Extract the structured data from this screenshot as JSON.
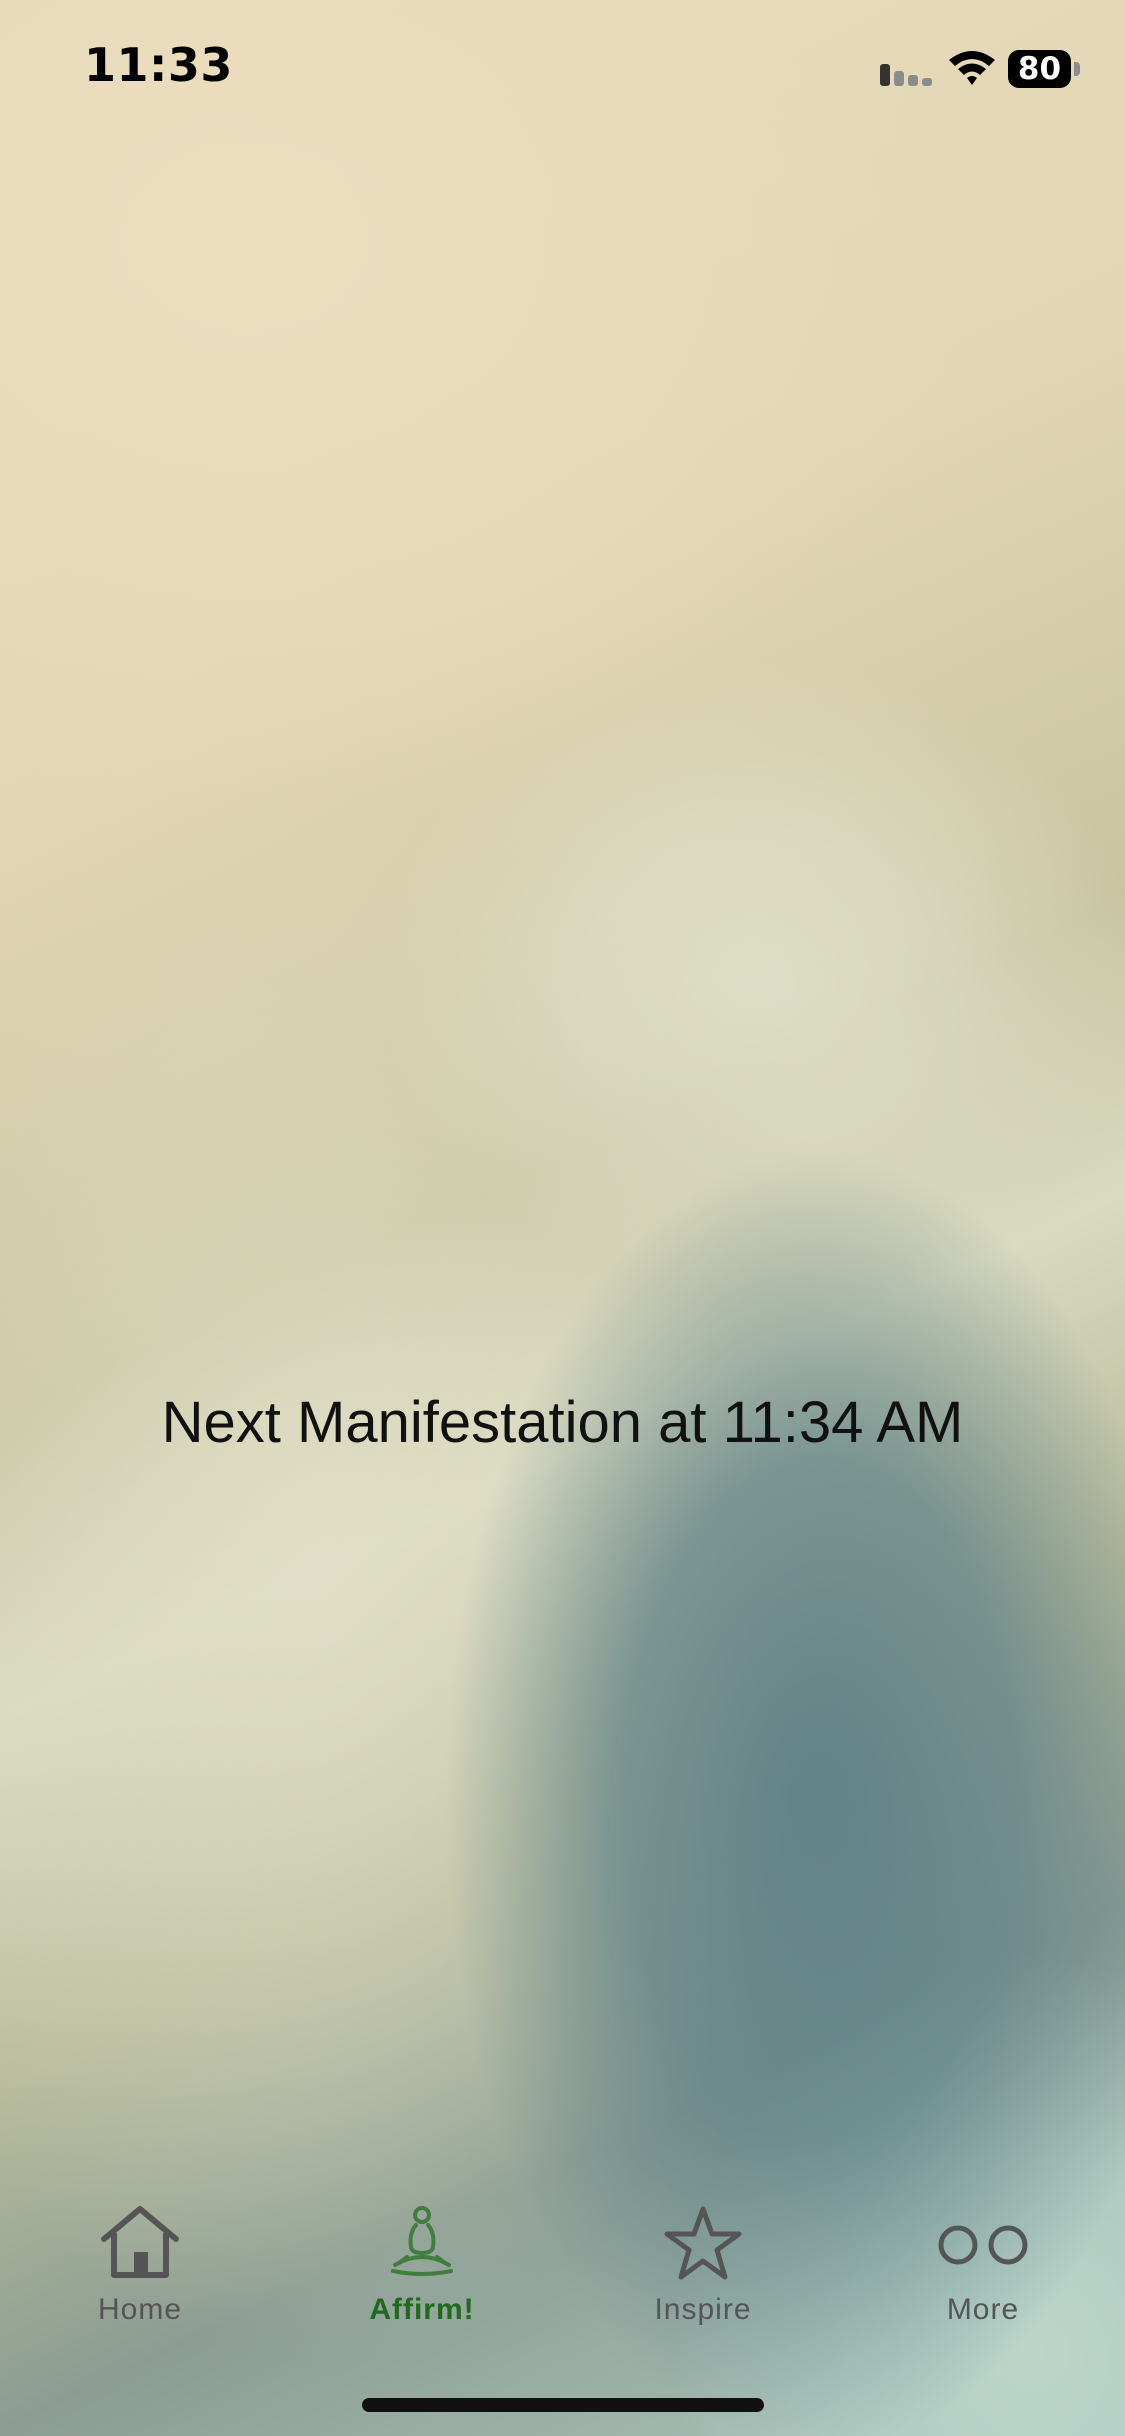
{
  "status_bar": {
    "time": "11:33",
    "battery_level": "80",
    "icons": [
      "signal-icon",
      "wifi-icon",
      "battery-icon"
    ]
  },
  "main": {
    "next_manifestation": "Next Manifestation at 11:34 AM"
  },
  "tab_bar": {
    "items": [
      {
        "label": "Home",
        "icon": "house-icon",
        "active": false
      },
      {
        "label": "Affirm!",
        "icon": "meditation-icon",
        "active": true
      },
      {
        "label": "Inspire",
        "icon": "star-icon",
        "active": false
      },
      {
        "label": "More",
        "icon": "more-icon",
        "active": false
      }
    ]
  },
  "colors": {
    "active_tab": "#1f6a1d",
    "inactive_tab": "#555555",
    "text": "#111111"
  }
}
